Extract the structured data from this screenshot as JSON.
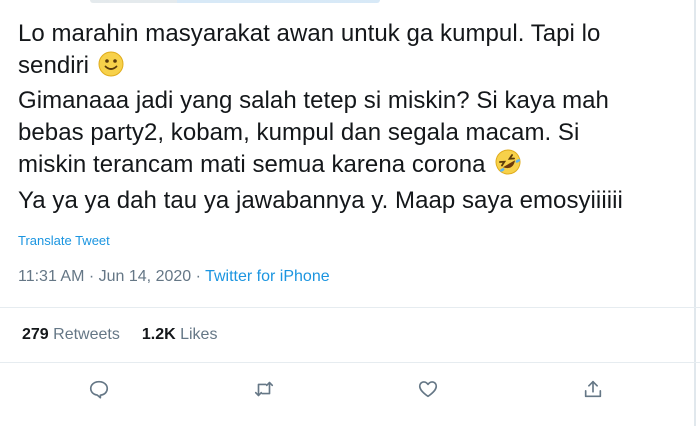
{
  "tweet": {
    "lines": [
      "Lo marahin masyarakat awan untuk ga kumpul. Tapi lo",
      "sendiri",
      "Gimanaaa jadi yang salah tetep si miskin? Si kaya mah",
      "bebas party2, kobam, kumpul dan segala macam. Si",
      "miskin terancam mati semua karena corona",
      "Ya ya ya dah tau ya jawabannya y. Maap saya emosyiiiiii"
    ],
    "emojis": [
      "slightly-smiling-face-icon",
      "rolling-on-floor-laughing-icon"
    ]
  },
  "translate_label": "Translate Tweet",
  "meta": {
    "time": "11:31 AM",
    "separator": " · ",
    "date": "Jun 14, 2020",
    "source": "Twitter for iPhone"
  },
  "stats": {
    "retweets_count": "279",
    "retweets_label": " Retweets",
    "likes_count": "1.2K",
    "likes_label": " Likes"
  },
  "actions": [
    "reply-icon",
    "retweet-icon",
    "like-icon",
    "share-icon"
  ],
  "colors": {
    "text": "#14171a",
    "link": "#1b95e0",
    "muted": "#657786",
    "divider": "#e6ecf0"
  }
}
